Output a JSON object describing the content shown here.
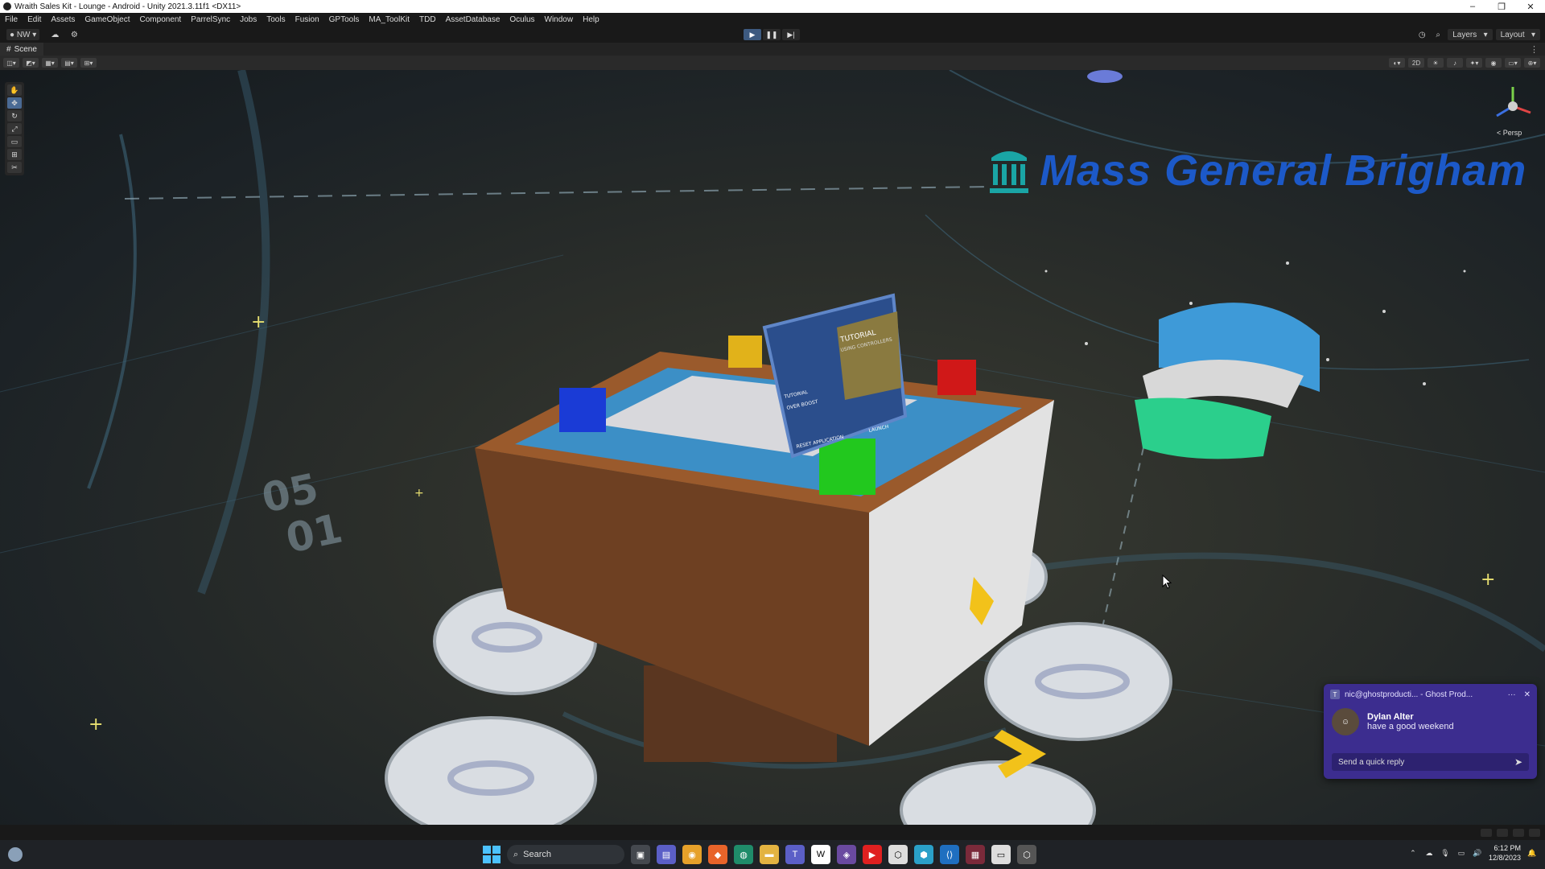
{
  "window": {
    "title": "Wraith Sales Kit - Lounge - Android - Unity 2021.3.11f1 <DX11>",
    "controls": [
      "–",
      "❐",
      "✕"
    ]
  },
  "menu": [
    "File",
    "Edit",
    "Assets",
    "GameObject",
    "Component",
    "ParrelSync",
    "Jobs",
    "Tools",
    "Fusion",
    "GPTools",
    "MA_ToolKit",
    "TDD",
    "AssetDatabase",
    "Oculus",
    "Window",
    "Help"
  ],
  "toolbar": {
    "account": "NW",
    "play": "▶",
    "pause": "❚❚",
    "step": "▶|",
    "layers": "Layers",
    "layout": "Layout"
  },
  "scene": {
    "tab_label": "Scene",
    "view_2d": "2D",
    "persp_label": "< Persp",
    "logo_text": "Mass General Brigham",
    "floor_numbers": [
      "05",
      "01"
    ],
    "screen_lines": [
      "TUTORIAL",
      "USING CONTROLLERS",
      "TUTORIAL",
      "OVER BOOST",
      "RESET APPLICATION",
      "LAUNCH"
    ]
  },
  "notification": {
    "account": "nic@ghostproducti... - Ghost Prod...",
    "dots": "···",
    "close": "✕",
    "sender": "Dylan Alter",
    "message": "have a good weekend",
    "reply_placeholder": "Send a quick reply",
    "send_icon": "➤"
  },
  "taskbar": {
    "search_label": "Search",
    "time": "6:12 PM",
    "date": "12/8/2023"
  },
  "colors": {
    "logo_blue": "#1c59c8",
    "notif_bg": "#3c2d8f",
    "play_active": "#3d5a80"
  }
}
